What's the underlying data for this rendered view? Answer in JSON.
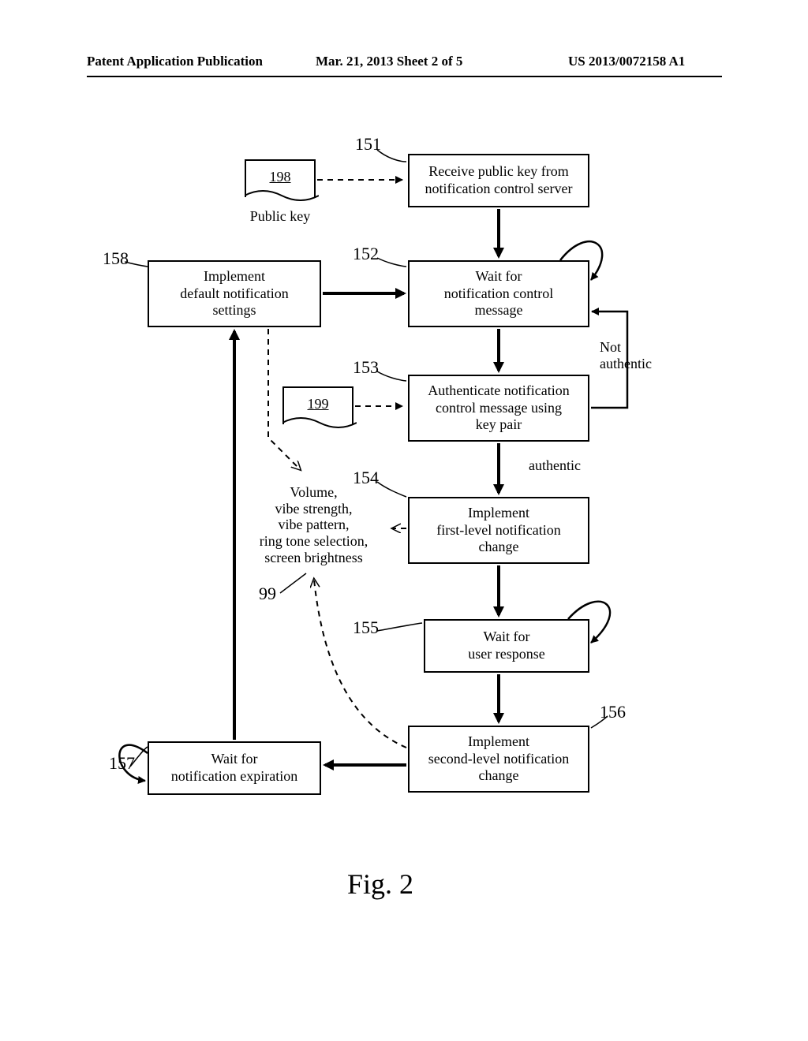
{
  "header": {
    "left": "Patent Application Publication",
    "center": "Mar. 21, 2013  Sheet 2 of 5",
    "right": "US 2013/0072158 A1"
  },
  "refs": {
    "r151": "151",
    "r152": "152",
    "r153": "153",
    "r154": "154",
    "r155": "155",
    "r156": "156",
    "r157": "157",
    "r158": "158",
    "r198": "198",
    "r199": "199",
    "r99": "99"
  },
  "docs": {
    "public_key_label": "Public key"
  },
  "boxes": {
    "b151": "Receive public key from\nnotification control server",
    "b152": "Wait for\nnotification control\nmessage",
    "b153": "Authenticate notification\ncontrol message using\nkey pair",
    "b154": "Implement\nfirst-level notification\nchange",
    "b155": "Wait for\nuser response",
    "b156": "Implement\nsecond-level notification\nchange",
    "b157": "Wait for\nnotification expiration",
    "b158": "Implement\ndefault notification\nsettings"
  },
  "edge_labels": {
    "not_authentic": "Not\nauthentic",
    "authentic": "authentic"
  },
  "annotation99": "Volume,\nvibe strength,\nvibe pattern,\nring tone selection,\nscreen brightness",
  "figure_caption": "Fig.  2"
}
